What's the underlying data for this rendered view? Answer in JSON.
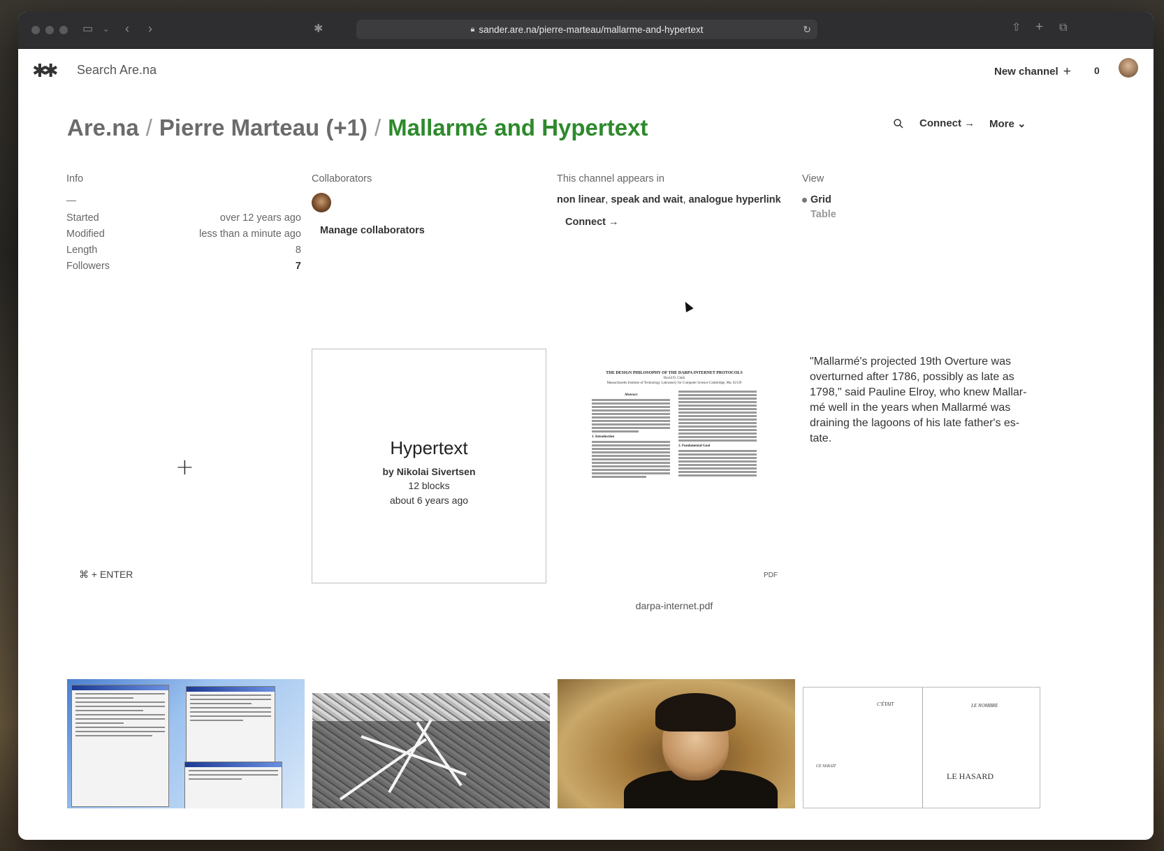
{
  "browser": {
    "url": "sander.are.na/pierre-marteau/mallarme-and-hypertext"
  },
  "nav": {
    "logo": "✱✱",
    "search_placeholder": "Search Are.na",
    "new_channel": "New channel",
    "new_channel_icon": "+",
    "notifications": "0"
  },
  "breadcrumb": {
    "root": "Are.na",
    "owner": "Pierre Marteau (+1)",
    "channel": "Mallarmé and Hypertext",
    "sep": "/"
  },
  "actions": {
    "connect": "Connect →",
    "more": "More ⌄"
  },
  "info": {
    "title": "Info",
    "description": "—",
    "rows": [
      {
        "label": "Started",
        "value": "over 12 years ago"
      },
      {
        "label": "Modified",
        "value": "less than a minute ago"
      },
      {
        "label": "Length",
        "value": "8"
      },
      {
        "label": "Followers",
        "value": "7"
      }
    ]
  },
  "collaborators": {
    "title": "Collaborators",
    "manage": "Manage collaborators"
  },
  "appears_in": {
    "title": "This channel appears in",
    "channels": [
      "non linear",
      "speak and wait",
      "analogue hyperlink"
    ],
    "comma": ",",
    "connect": "Connect →"
  },
  "view": {
    "title": "View",
    "options": [
      "Grid",
      "Table"
    ],
    "active": "Grid"
  },
  "blocks": {
    "add": {
      "icon": "+",
      "hint": "⌘ + ENTER"
    },
    "channel": {
      "title": "Hypertext",
      "author": "by Nikolai Sivertsen",
      "count": "12 blocks",
      "updated": "about 6 years ago"
    },
    "pdf": {
      "doc_title": "THE DESIGN PHILOSOPHY OF THE DARPA INTERNET PROTOCOLS",
      "doc_author": "David D. Clark",
      "doc_affiliation": "Massachusetts Institute of Technology Laboratory for Computer Science Cambridge, Ma. 02139",
      "doc_abstract": "Abstract",
      "doc_sec1": "1. Introduction",
      "doc_sec2": "2. Fundamental Goal",
      "badge": "PDF",
      "caption": "darpa-internet.pdf"
    },
    "text": "\"Mallarmé's projected 19th Overture was overturned after 1786, possibly as late as 1798,\" said Pauline Elroy, who knew Mallar-mé well in the years when Mallarmé was draining the lagoons of his late father's es-tate."
  },
  "thumbs": {
    "book_left": "C'ÉTAIT",
    "book_left2": "CE SERAIT",
    "book_right": "LE NOMBRE",
    "book_right2": "LE HASARD"
  }
}
